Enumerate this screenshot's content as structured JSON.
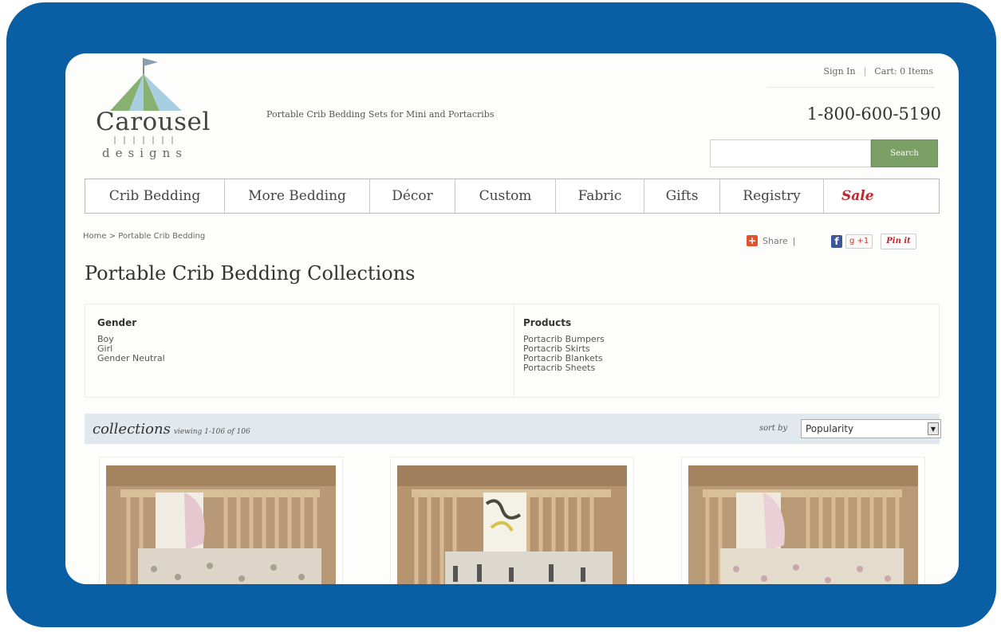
{
  "header": {
    "logo_word": "Carousel",
    "logo_sub": "designs",
    "tagline": "Portable Crib Bedding Sets for Mini and Portacribs",
    "sign_in": "Sign In",
    "cart": "Cart: 0 Items",
    "phone": "1-800-600-5190",
    "search_placeholder": "",
    "search_button": "Search"
  },
  "nav": [
    {
      "label": "Crib Bedding"
    },
    {
      "label": "More Bedding"
    },
    {
      "label": "Décor"
    },
    {
      "label": "Custom"
    },
    {
      "label": "Fabric"
    },
    {
      "label": "Gifts"
    },
    {
      "label": "Registry"
    },
    {
      "label": "Sale"
    }
  ],
  "breadcrumb": "Home > Portable Crib Bedding",
  "share": {
    "label": "Share",
    "sep": "|",
    "gplus": "+1",
    "pin": "Pin it"
  },
  "page_title": "Portable Crib Bedding Collections",
  "filters": {
    "gender": {
      "title": "Gender",
      "options": [
        "Boy",
        "Girl",
        "Gender Neutral"
      ]
    },
    "products": {
      "title": "Products",
      "options": [
        "Portacrib Bumpers",
        "Portacrib Skirts",
        "Portacrib Blankets",
        "Portacrib Sheets"
      ]
    }
  },
  "collections": {
    "title": "collections",
    "viewing": "viewing 1-106 of 106",
    "sort_label": "sort by",
    "sort_value": "Popularity"
  },
  "colors": {
    "frame": "#0a5ea3",
    "search_button": "#7aa065",
    "sale": "#c0272d",
    "collections_bar": "#e1e9ee"
  }
}
